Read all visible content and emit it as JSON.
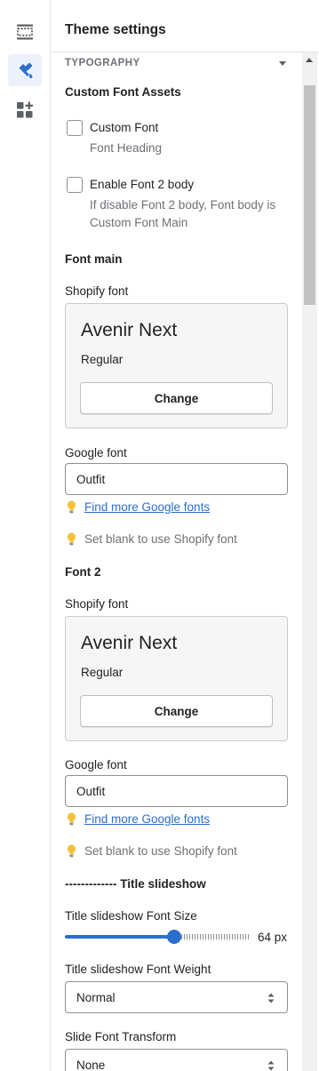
{
  "rail": {
    "items": [
      {
        "name": "sections",
        "icon": "sections-icon",
        "active": false
      },
      {
        "name": "theme-settings",
        "icon": "paint-brush-icon",
        "active": true
      },
      {
        "name": "apps",
        "icon": "apps-add-icon",
        "active": false
      }
    ]
  },
  "header": {
    "title": "Theme settings"
  },
  "section": {
    "label": "TYPOGRAPHY"
  },
  "custom_assets": {
    "heading": "Custom Font Assets",
    "custom_font": {
      "label": "Custom Font",
      "help": "Font Heading",
      "checked": false
    },
    "font2_body": {
      "label": "Enable Font 2 body",
      "help_line1": "If disable Font 2 body, Font body is",
      "help_line2": "Custom Font Main",
      "checked": false
    }
  },
  "font_main": {
    "heading": "Font main",
    "shopify_label": "Shopify font",
    "font_name": "Avenir Next",
    "font_style": "Regular",
    "change_label": "Change",
    "google_label": "Google font",
    "google_value": "Outfit",
    "find_link": "Find more Google fonts",
    "blank_tip": "Set blank to use Shopify font"
  },
  "font_2": {
    "heading": "Font 2",
    "shopify_label": "Shopify font",
    "font_name": "Avenir Next",
    "font_style": "Regular",
    "change_label": "Change",
    "google_label": "Google font",
    "google_value": "Outfit",
    "find_link": "Find more Google fonts",
    "blank_tip": "Set blank to use Shopify font"
  },
  "slideshow": {
    "divider_text": "------------- Title slideshow",
    "size_label": "Title slideshow Font Size",
    "size_value": 64,
    "size_min": 10,
    "size_max": 100,
    "size_display": "64 px",
    "weight_label": "Title slideshow Font Weight",
    "weight_value": "Normal",
    "transform_label": "Slide Font Transform",
    "transform_value": "None"
  },
  "colors": {
    "accent": "#2c6ecb",
    "active_bg": "#edf1fb"
  }
}
